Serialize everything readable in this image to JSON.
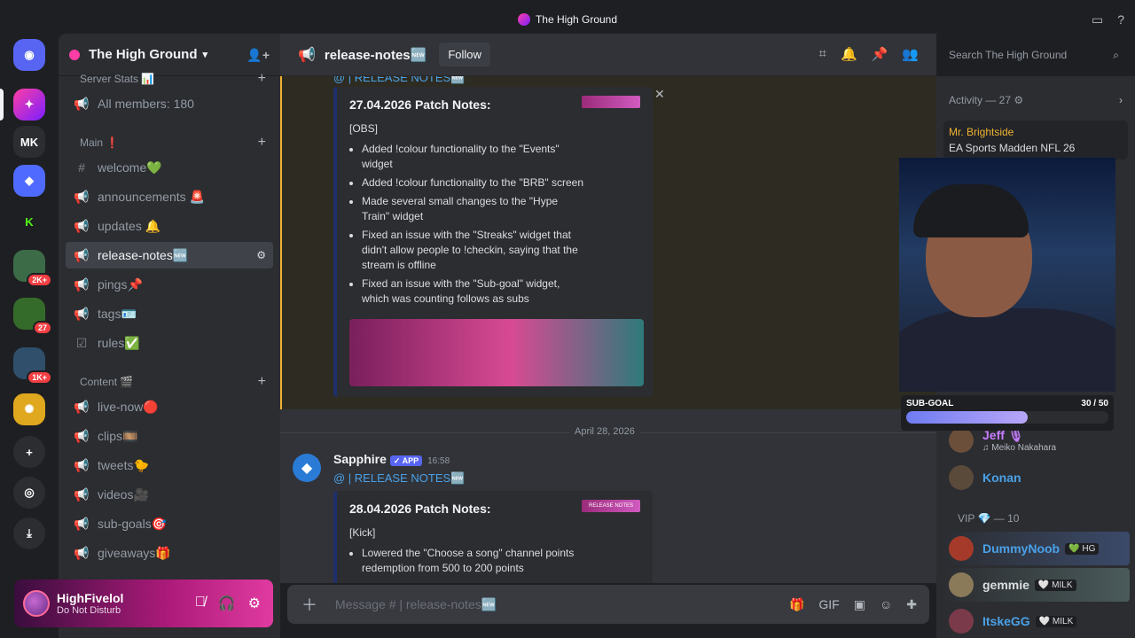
{
  "window": {
    "title": "The High Ground"
  },
  "servers": {
    "mk_label": "MK",
    "badges": [
      "2K+",
      "27",
      "1K+"
    ]
  },
  "guild": {
    "name": "The High Ground"
  },
  "sidebar": {
    "top_items": [
      {
        "label": "Server Stats 📊"
      },
      {
        "label": "All members: 180"
      }
    ],
    "cat_main": "Main ❗",
    "main_channels": [
      {
        "label": "welcome💚"
      },
      {
        "label": "announcements 🚨"
      },
      {
        "label": "updates 🔔"
      },
      {
        "label": "release-notes🆕"
      },
      {
        "label": "pings📌"
      },
      {
        "label": "tags🪪"
      },
      {
        "label": "rules✅"
      }
    ],
    "cat_content": "Content 🎬",
    "content_channels": [
      {
        "label": "live-now🔴"
      },
      {
        "label": "clips🎞️"
      },
      {
        "label": "tweets🐤"
      },
      {
        "label": "videos🎥"
      },
      {
        "label": "sub-goals🎯"
      },
      {
        "label": "giveaways🎁"
      }
    ]
  },
  "user": {
    "name": "HighFivelol",
    "status": "Do Not Disturb"
  },
  "header": {
    "channel": "release-notes🆕",
    "follow": "Follow",
    "search_placeholder": "Search The High Ground"
  },
  "messages": {
    "reply_ref_1": "@ | RELEASE NOTES🆕",
    "embed1": {
      "title": "27.04.2026 Patch Notes:",
      "section": "[OBS]",
      "tag": "",
      "items": [
        "Added !colour functionality to the \"Events\" widget",
        "Added !colour functionality to the \"BRB\" screen",
        "Made several small changes to the \"Hype Train\" widget",
        "Fixed an issue with the \"Streaks\" widget that didn't allow people to !checkin, saying that the stream is offline",
        "Fixed an issue with the \"Sub-goal\" widget, which was counting follows as subs"
      ]
    },
    "date_divider": "April 28, 2026",
    "msg2": {
      "author": "Sapphire",
      "app": "✓ APP",
      "time": "16:58",
      "reply_ref": "@ | RELEASE NOTES🆕",
      "title": "28.04.2026 Patch Notes:",
      "tag": "RELEASE NOTES",
      "section": "[Kick]",
      "items": [
        "Lowered the \"Choose a song\" channel points redemption from 500 to 200 points"
      ]
    }
  },
  "composer": {
    "placeholder": "Message # | release-notes🆕"
  },
  "members": {
    "activity_label": "Activity — 27 ⚙",
    "activity_user": "Mr. Brightside",
    "activity_game": "EA Sports Madden NFL 26",
    "rows": [
      {
        "name": "Jeff 🎙",
        "sub": "♫ Meiko Nakahara",
        "color": "#c77dff"
      },
      {
        "name": "Konan",
        "color": "#4aa1e8"
      }
    ],
    "vip_label": "VIP 💎 — 10",
    "vip_rows": [
      {
        "name": "DummyNoob",
        "tag": "💚 HG",
        "color": "#4aa1e8"
      },
      {
        "name": "gemmie",
        "tag": "🤍 MILK",
        "color": "#dbdee1"
      },
      {
        "name": "ItskeGG",
        "tag": "🤍 MILK",
        "color": "#4aa1e8"
      }
    ]
  },
  "subgoal": {
    "label": "SUB-GOAL",
    "value": "30 / 50",
    "progress": 0.6
  }
}
